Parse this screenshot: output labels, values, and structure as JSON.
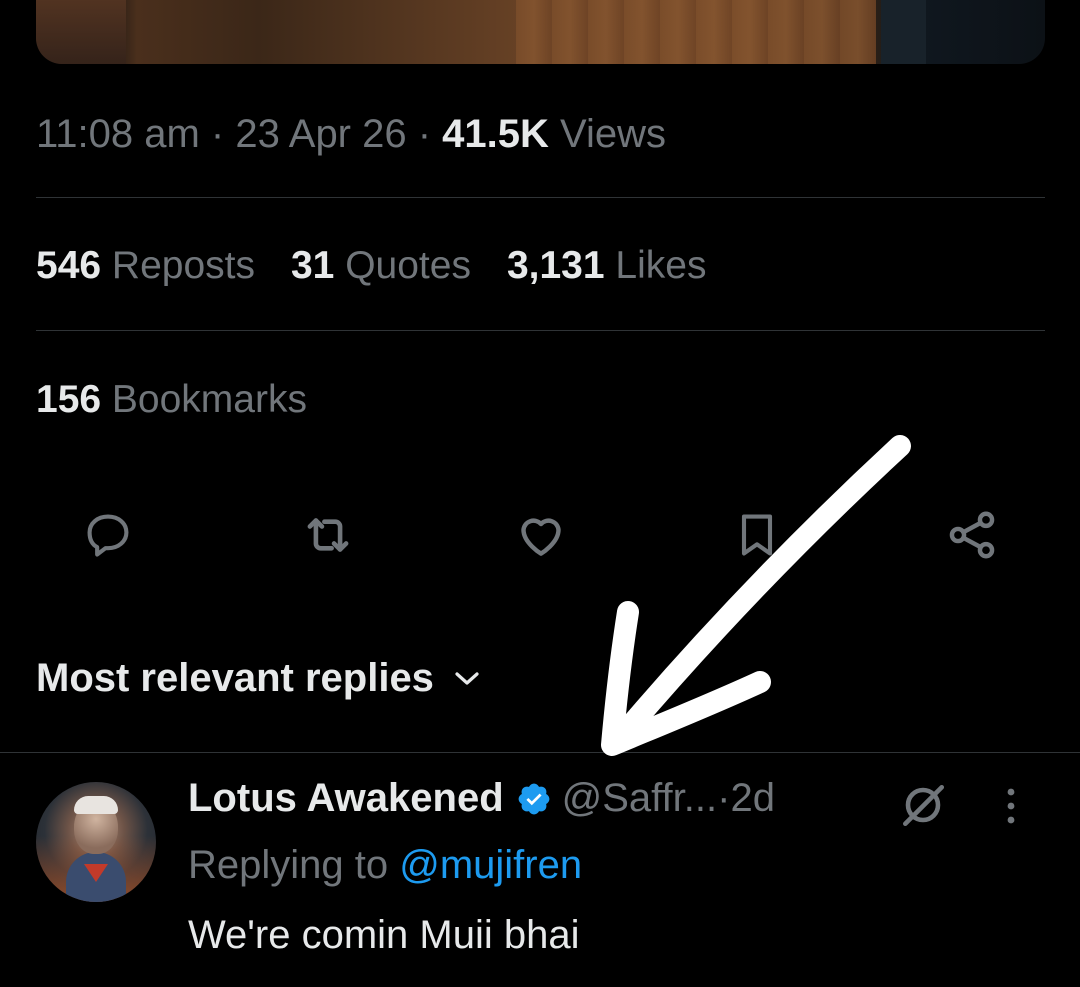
{
  "post_meta": {
    "time": "11:08 am",
    "sep1": " · ",
    "date": "23 Apr 26",
    "sep2": " · ",
    "views_count": "41.5K",
    "views_label": " Views"
  },
  "stats": {
    "reposts_count": "546",
    "reposts_label": " Reposts",
    "quotes_count": "31",
    "quotes_label": " Quotes",
    "likes_count": "3,131",
    "likes_label": " Likes",
    "bookmarks_count": "156",
    "bookmarks_label": " Bookmarks"
  },
  "actions": {
    "icons": [
      "reply-icon",
      "repost-icon",
      "like-icon",
      "bookmark-icon",
      "share-icon"
    ],
    "icon_color": "#71767b"
  },
  "replies": {
    "sort_label": "Most relevant replies",
    "reply": {
      "name": "Lotus Awakened",
      "handle": "@Saffr...",
      "dot": " · ",
      "time": "2d",
      "replying_prefix": "Replying to ",
      "replying_to": "@mujifren",
      "text": "We're comin Muii bhai"
    }
  },
  "colors": {
    "background": "#000000",
    "primary_text": "#e7e9ea",
    "secondary_text": "#71767b",
    "accent": "#1d9bf0",
    "divider": "#2f3336",
    "annotation_arrow": "#ffffff"
  }
}
